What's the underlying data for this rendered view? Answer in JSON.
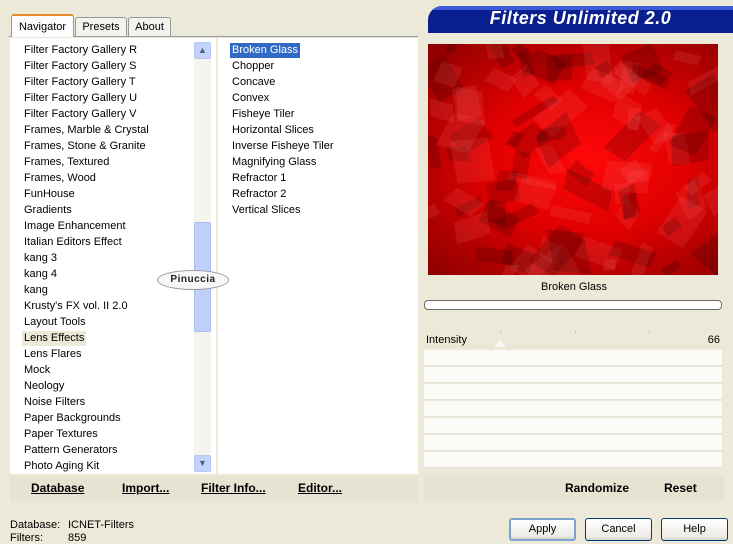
{
  "tabs": [
    {
      "label": "Navigator",
      "active": true
    },
    {
      "label": "Presets",
      "active": false
    },
    {
      "label": "About",
      "active": false
    }
  ],
  "banner_title": "Filters Unlimited 2.0",
  "categories": [
    "Filter Factory Gallery R",
    "Filter Factory Gallery S",
    "Filter Factory Gallery T",
    "Filter Factory Gallery U",
    "Filter Factory Gallery V",
    "Frames, Marble & Crystal",
    "Frames, Stone & Granite",
    "Frames, Textured",
    "Frames, Wood",
    "FunHouse",
    "Gradients",
    "Image Enhancement",
    "Italian Editors Effect",
    "kang 3",
    "kang 4",
    "kang",
    "Krusty's FX vol. II 2.0",
    "Layout Tools",
    "Lens Effects",
    "Lens Flares",
    "Mock",
    "Neology",
    "Noise Filters",
    "Paper Backgrounds",
    "Paper Textures",
    "Pattern Generators",
    "Photo Aging Kit"
  ],
  "selected_category": "Lens Effects",
  "filters": [
    "Broken Glass",
    "Chopper",
    "Concave",
    "Convex",
    "Fisheye Tiler",
    "Horizontal Slices",
    "Inverse Fisheye Tiler",
    "Magnifying Glass",
    "Refractor 1",
    "Refractor 2",
    "Vertical Slices"
  ],
  "selected_filter": "Broken Glass",
  "watermark_text": "Pinuccia",
  "preview": {
    "caption": "Broken Glass",
    "colors": {
      "bright": "#ff0808",
      "dark": "#8a0000"
    }
  },
  "parameter": {
    "label": "Intensity",
    "value": "66"
  },
  "left_actions": {
    "database": "Database",
    "import": "Import...",
    "filter_info": "Filter Info...",
    "editor": "Editor..."
  },
  "right_actions": {
    "randomize": "Randomize",
    "reset": "Reset"
  },
  "footer": {
    "database_label": "Database:",
    "database_value": "ICNET-Filters",
    "filters_label": "Filters:",
    "filters_value": "859"
  },
  "buttons": {
    "apply": "Apply",
    "cancel": "Cancel",
    "help": "Help"
  },
  "icons": {
    "scroll_up": "▲",
    "scroll_down": "▼"
  }
}
